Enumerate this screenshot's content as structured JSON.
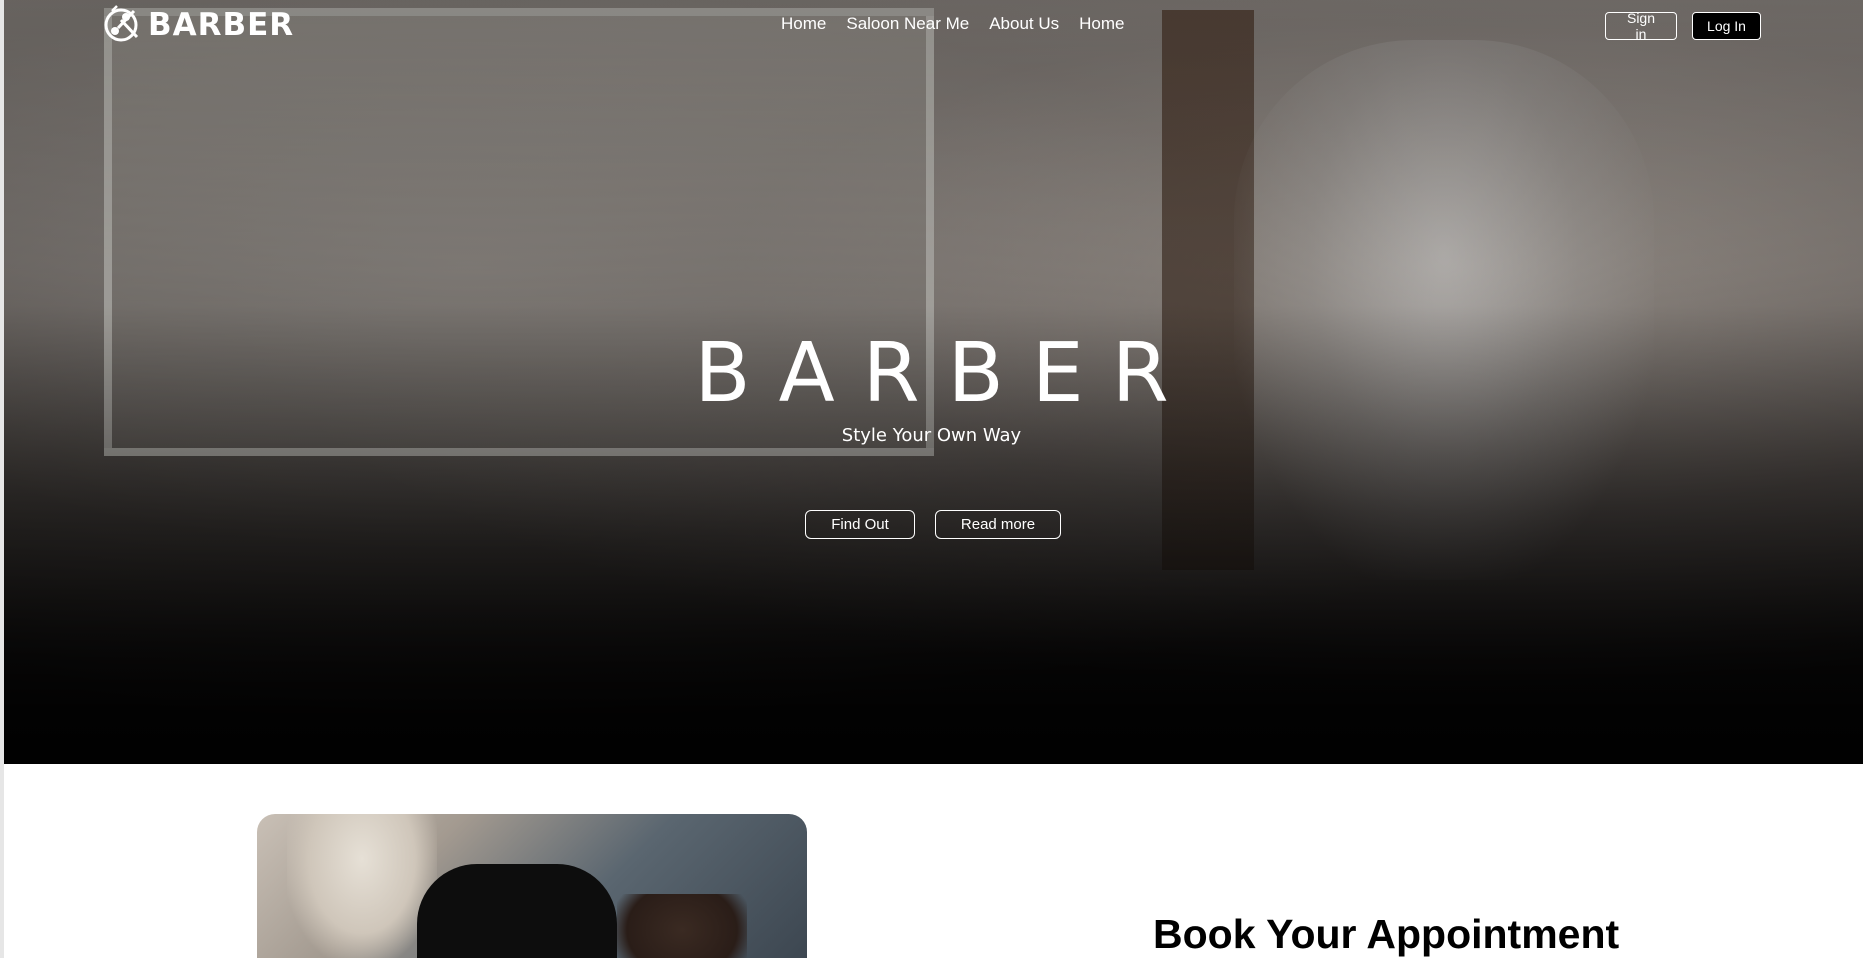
{
  "brand": {
    "name": "BARBER",
    "logo_icon": "scissors-comb-logo-icon"
  },
  "nav": {
    "items": [
      {
        "label": "Home"
      },
      {
        "label": "Saloon Near Me"
      },
      {
        "label": "About Us"
      },
      {
        "label": "Home"
      }
    ]
  },
  "auth": {
    "sign_in": "Sign in",
    "log_in": "Log In"
  },
  "hero": {
    "title": "BARBER",
    "tagline": "Style Your Own Way",
    "find_out": "Find Out",
    "read_more": "Read more"
  },
  "booking": {
    "title": "Book Your Appointment"
  },
  "colors": {
    "hero_text": "#ffffff",
    "login_bg": "#000000",
    "page_bg": "#ffffff"
  }
}
